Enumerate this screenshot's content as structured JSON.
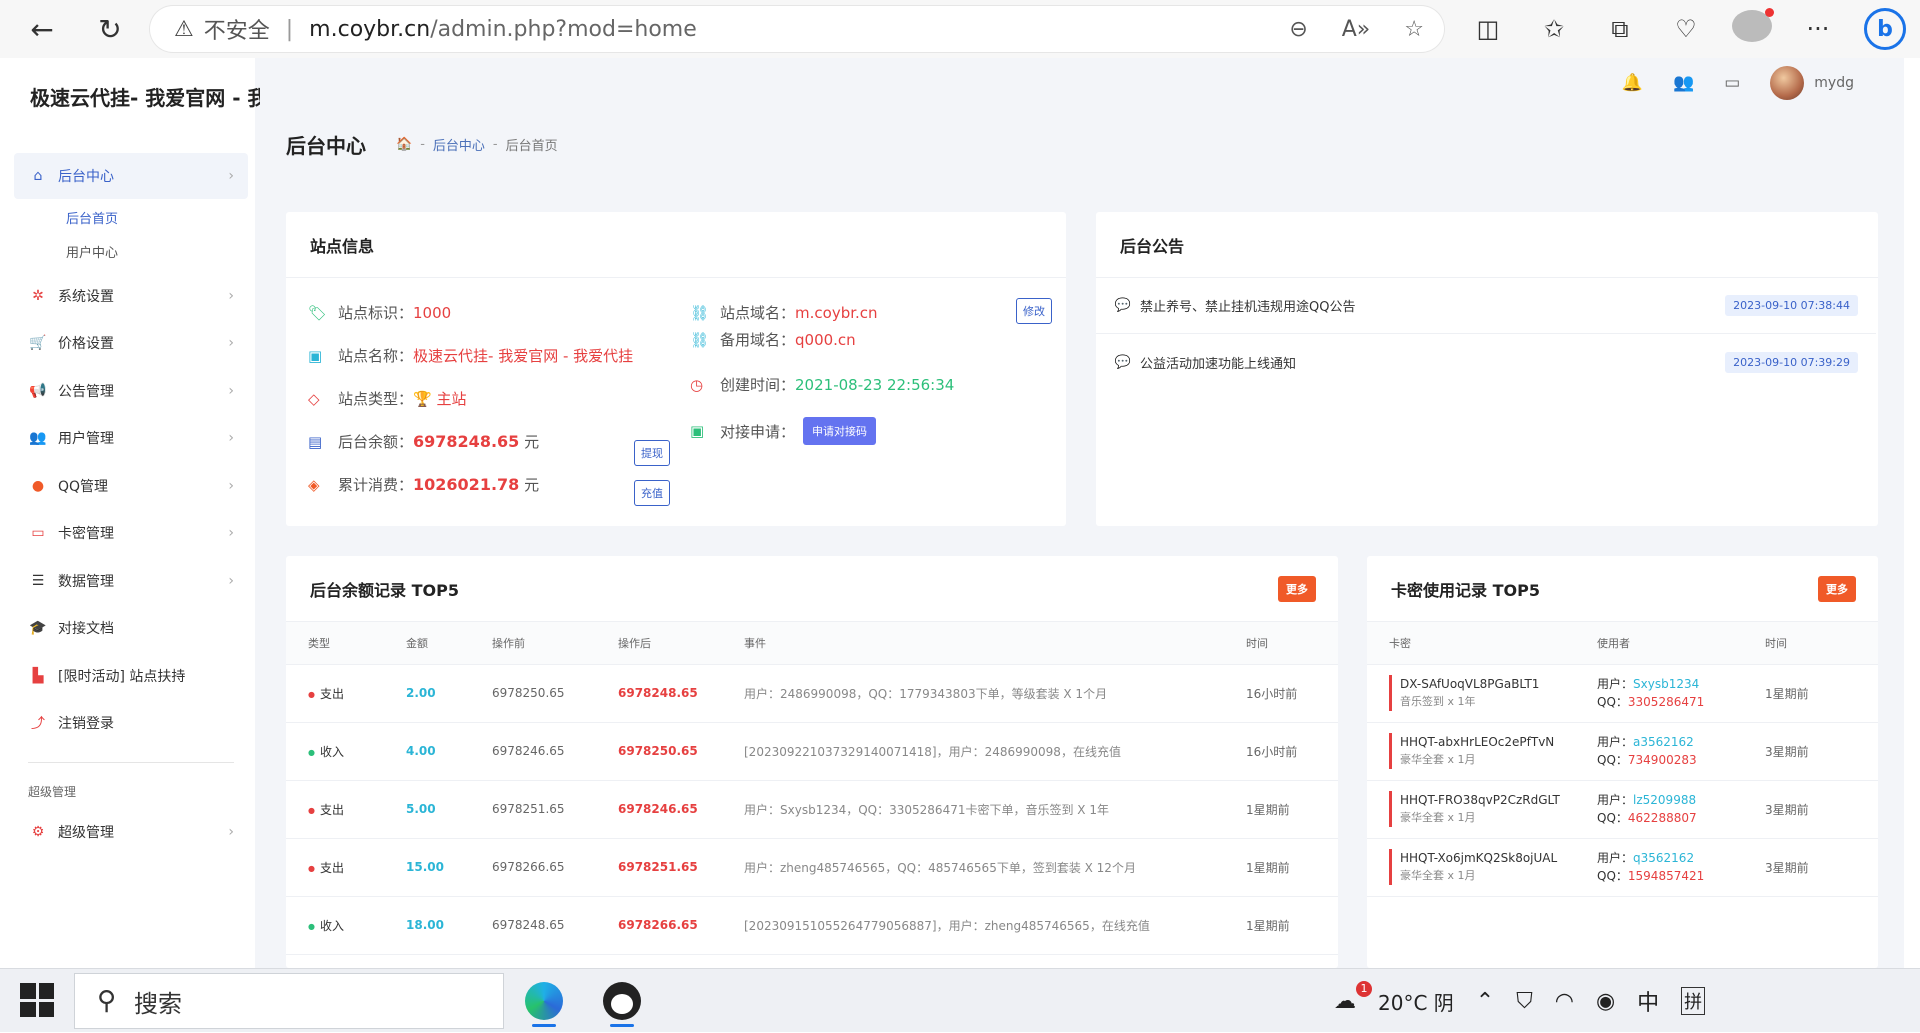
{
  "browser": {
    "insecure_label": "不安全",
    "url_host": "m.coybr.cn",
    "url_path": "/admin.php?mod=home"
  },
  "header": {
    "brand": "极速云代挂- 我爱官网 - 我",
    "user_name": "mydg"
  },
  "sidebar": {
    "items": [
      {
        "label": "后台中心",
        "icon": "home-icon"
      },
      {
        "label": "系统设置",
        "icon": "gear-icon"
      },
      {
        "label": "价格设置",
        "icon": "cart-icon"
      },
      {
        "label": "公告管理",
        "icon": "megaphone-icon"
      },
      {
        "label": "用户管理",
        "icon": "users-icon"
      },
      {
        "label": "QQ管理",
        "icon": "qq-icon"
      },
      {
        "label": "卡密管理",
        "icon": "card-icon"
      },
      {
        "label": "数据管理",
        "icon": "list-icon"
      },
      {
        "label": "对接文档",
        "icon": "graduation-cap-icon"
      },
      {
        "label": "[限时活动] 站点扶持",
        "icon": "chart-icon"
      },
      {
        "label": "注销登录",
        "icon": "logout-icon"
      }
    ],
    "sub_items": [
      "后台首页",
      "用户中心"
    ],
    "section_head": "超级管理",
    "super_item": "超级管理"
  },
  "page": {
    "title": "后台中心",
    "breadcrumb": [
      "后台中心",
      "后台首页"
    ]
  },
  "site_info": {
    "title": "站点信息",
    "id_label": "站点标识：",
    "id_value": "1000",
    "name_label": "站点名称：",
    "name_value": "极速云代挂- 我爱官网 - 我爱代挂",
    "type_label": "站点类型：",
    "type_value": "主站",
    "balance_label": "后台余额：",
    "balance_value": "6978248.65",
    "consume_label": "累计消费：",
    "consume_value": "1026021.78",
    "unit": "元",
    "domain_label": "站点域名：",
    "domain_value": "m.coybr.cn",
    "backup_label": "备用域名：",
    "backup_value": "q000.cn",
    "created_label": "创建时间：",
    "created_value": "2021-08-23 22:56:34",
    "apply_label": "对接申请：",
    "apply_btn": "申请对接码",
    "edit_btn": "修改",
    "withdraw_btn": "提现",
    "recharge_btn": "充值"
  },
  "notices": {
    "title": "后台公告",
    "items": [
      {
        "text": "禁止养号、禁止挂机违规用途QQ公告",
        "date": "2023-09-10 07:38:44",
        "color": "#e64040"
      },
      {
        "text": "公益活动加速功能上线通知",
        "date": "2023-09-10 07:39:29",
        "color": "#2cbf7a"
      }
    ]
  },
  "balance_records": {
    "title": "后台余额记录 TOP5",
    "more": "更多",
    "columns": [
      "类型",
      "金额",
      "操作前",
      "操作后",
      "事件",
      "时间"
    ],
    "rows": [
      {
        "type": "支出",
        "type_color": "#e64040",
        "amount": "2.00",
        "before": "6978250.65",
        "after": "6978248.65",
        "event": "用户：2486990098，QQ：1779343803下单，等级套装 X 1个月",
        "time": "16小时前"
      },
      {
        "type": "收入",
        "type_color": "#2cbf7a",
        "amount": "4.00",
        "before": "6978246.65",
        "after": "6978250.65",
        "event": "[2023092210373291400714​18]，用户：2486990098，在线充值",
        "time": "16小时前"
      },
      {
        "type": "支出",
        "type_color": "#e64040",
        "amount": "5.00",
        "before": "6978251.65",
        "after": "6978246.65",
        "event": "用户：Sxysb1234，QQ：3305286471卡密下单，音乐签到 X 1年",
        "time": "1星期前"
      },
      {
        "type": "支出",
        "type_color": "#e64040",
        "amount": "15.00",
        "before": "6978266.65",
        "after": "6978251.65",
        "event": "用户：zheng485746565，QQ：485746565下单，签到套装 X 12个月",
        "time": "1星期前"
      },
      {
        "type": "收入",
        "type_color": "#2cbf7a",
        "amount": "18.00",
        "before": "6978248.65",
        "after": "6978266.65",
        "event": "[20230915105526477905688​7]，用户：zheng485746565，在线充值",
        "time": "1星期前"
      }
    ]
  },
  "card_records": {
    "title": "卡密使用记录 TOP5",
    "more": "更多",
    "columns": [
      "卡密",
      "使用者",
      "时间"
    ],
    "user_prefix": "用户：",
    "qq_prefix": "QQ：",
    "rows": [
      {
        "key": "DX-SAfUoqVL8PGaBLT1",
        "desc": "音乐签到 x 1年",
        "user": "Sxysb1234",
        "qq": "3305286471",
        "time": "1星期前"
      },
      {
        "key": "HHQT-abxHrLEOc2ePfTvN",
        "desc": "豪华全套 x 1月",
        "user": "a3562162",
        "qq": "734900283",
        "time": "3星期前"
      },
      {
        "key": "HHQT-FRO38qvP2CzRdGLT",
        "desc": "豪华全套 x 1月",
        "user": "lz5209988",
        "qq": "462288807",
        "time": "3星期前"
      },
      {
        "key": "HHQT-Xo6jmKQ2Sk8ojUAL",
        "desc": "豪华全套 x 1月",
        "user": "q3562162",
        "qq": "1594857421",
        "time": "3星期前"
      }
    ]
  },
  "taskbar": {
    "search_label": "搜索",
    "weather_badge": "1",
    "weather": "20°C 阴",
    "ime1": "中",
    "ime2": "拼"
  }
}
